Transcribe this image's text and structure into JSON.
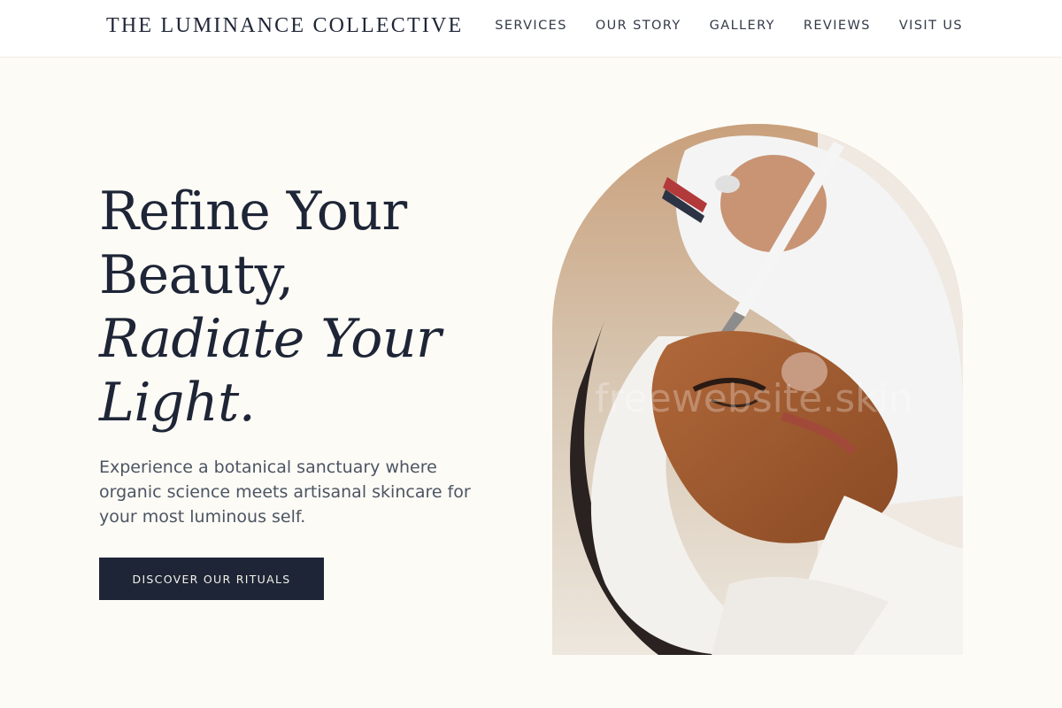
{
  "header": {
    "brand": "THE LUMINANCE COLLECTIVE",
    "nav": [
      {
        "label": "SERVICES"
      },
      {
        "label": "OUR STORY"
      },
      {
        "label": "GALLERY"
      },
      {
        "label": "REVIEWS"
      },
      {
        "label": "VISIT US"
      }
    ]
  },
  "hero": {
    "title_line1": "Refine Your",
    "title_line2": "Beauty,",
    "title_line3": "Radiate Your",
    "title_line4": "Light.",
    "subtitle": "Experience a botanical sanctuary where organic science meets artisanal skincare for your most luminous self.",
    "cta_label": "DISCOVER OUR RITUALS",
    "watermark": "freewebsite.skin"
  },
  "colors": {
    "background": "#fdfbf6",
    "header_bg": "#ffffff",
    "primary_dark": "#1e2536",
    "text_muted": "#4b5563"
  }
}
